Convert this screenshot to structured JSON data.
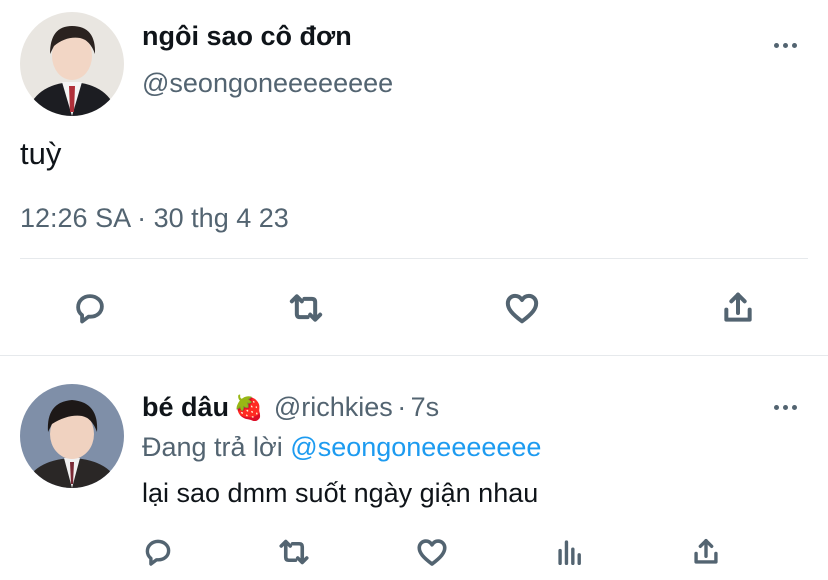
{
  "tweet": {
    "display_name": "ngôi sao cô đơn",
    "handle": "@seongoneeeeeeee",
    "text": "tuỳ",
    "time": "12:26 SA",
    "separator": "·",
    "date": "30 thg 4 23",
    "actions": [
      "reply-icon",
      "retweet-icon",
      "like-icon",
      "share-icon"
    ]
  },
  "reply": {
    "display_name": "bé dâu",
    "emoji": "🍓",
    "handle": "@richkies",
    "separator": "·",
    "time_ago": "7s",
    "replying_label": "Đang trả lời",
    "replying_to": "@seongoneeeeeeee",
    "text": "lại sao dmm suốt ngày giận nhau",
    "actions": [
      "reply-icon",
      "retweet-icon",
      "like-icon",
      "analytics-icon",
      "share-icon"
    ]
  },
  "colors": {
    "text": "#0f1419",
    "secondary": "#536471",
    "accent": "#1d9bf0",
    "divider": "#e6e9ec"
  }
}
